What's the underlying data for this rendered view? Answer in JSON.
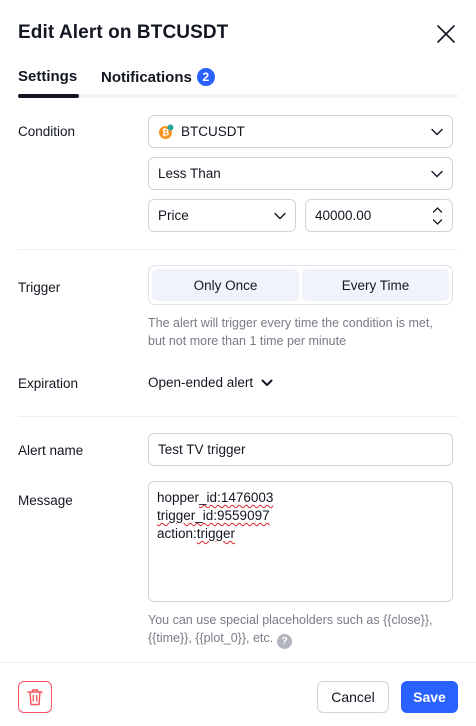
{
  "dialog": {
    "title": "Edit Alert on BTCUSDT"
  },
  "tabs": [
    {
      "label": "Settings",
      "active": true
    },
    {
      "label": "Notifications",
      "badge": "2"
    }
  ],
  "condition": {
    "label": "Condition",
    "symbol": "BTCUSDT",
    "operator": "Less Than",
    "source": "Price",
    "value": "40000.00"
  },
  "trigger": {
    "label": "Trigger",
    "options": [
      "Only Once",
      "Every Time"
    ],
    "hint": "The alert will trigger every time the condition is met, but not more than 1 time per minute"
  },
  "expiration": {
    "label": "Expiration",
    "value": "Open-ended alert"
  },
  "alert_name": {
    "label": "Alert name",
    "value": "Test TV trigger"
  },
  "message": {
    "label": "Message",
    "lines": [
      {
        "prefix": "hopper",
        "squiggle": "_id:1476003",
        "suffix": ""
      },
      {
        "prefix": "",
        "squiggle": "trigger_id:9559097",
        "suffix": ""
      },
      {
        "prefix": "action:",
        "squiggle": "trigger",
        "suffix": ""
      }
    ],
    "hint": "You can use special placeholders such as {{close}}, {{time}}, {{plot_0}}, etc."
  },
  "footer": {
    "cancel_label": "Cancel",
    "save_label": "Save"
  },
  "colors": {
    "accent": "#2962ff",
    "danger": "#f7525f",
    "bitcoin": "#f7931a"
  }
}
